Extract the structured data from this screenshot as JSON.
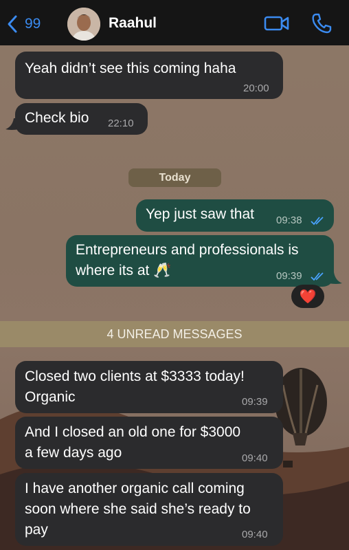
{
  "header": {
    "back_count": "99",
    "contact_name": "Raahul"
  },
  "messages": [
    {
      "direction": "in",
      "text": "Yeah didn’t see this coming haha",
      "time": "20:00"
    },
    {
      "direction": "in",
      "text": "Check bio",
      "time": "22:10"
    },
    {
      "direction": "out",
      "text": "Yep just saw that",
      "time": "09:38",
      "status": "read"
    },
    {
      "direction": "out",
      "text": "Entrepreneurs and professionals is\nwhere its at 🥂",
      "time": "09:39",
      "status": "read",
      "reaction": "❤️"
    },
    {
      "direction": "in",
      "text": "Closed two clients at $3333 today!\nOrganic",
      "time": "09:39"
    },
    {
      "direction": "in",
      "text": "And I closed an old one for $3000\na few days ago",
      "time": "09:40"
    },
    {
      "direction": "in",
      "text": "I have another organic call coming\nsoon where she said she’s ready to\npay",
      "time": "09:40"
    }
  ],
  "date_divider": "Today",
  "unread_divider": "4 UNREAD MESSAGES",
  "colors": {
    "header_bg": "#151515",
    "accent_blue": "#3b8bf0",
    "incoming_bubble": "#2b2b2d",
    "outgoing_bubble": "#1f4d43",
    "read_tick": "#4aa3ff"
  },
  "icons": [
    "chevron-left-icon",
    "video-camera-icon",
    "phone-icon",
    "double-check-icon",
    "heart-reaction-icon"
  ]
}
